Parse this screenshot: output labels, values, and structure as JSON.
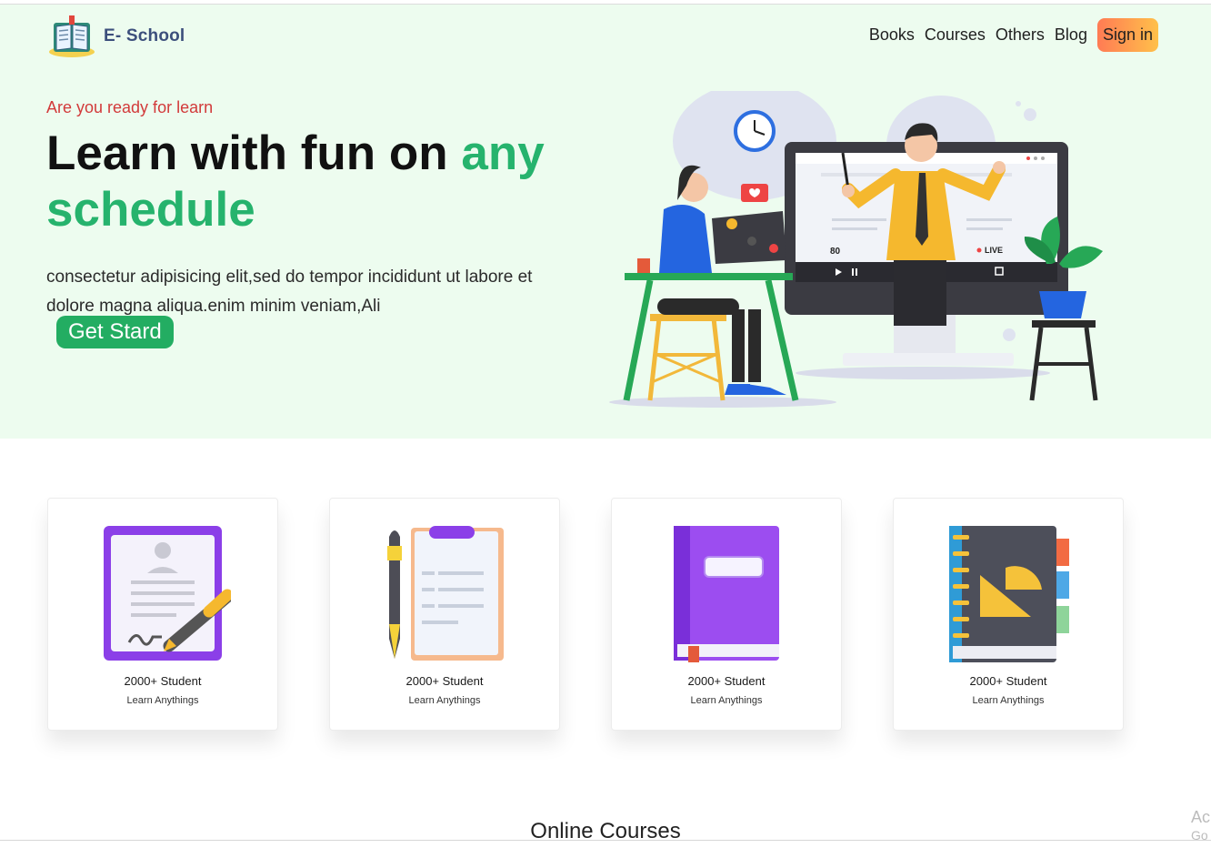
{
  "brand": {
    "name": "E- School",
    "logo_icon": "open-book-logo-icon"
  },
  "nav": {
    "items": [
      "Books",
      "Courses",
      "Others",
      "Blog"
    ],
    "signin_label": "Sign in"
  },
  "hero": {
    "tagline": "Are you ready for learn",
    "headline_part1": "Learn with fun on ",
    "headline_accent": "any schedule",
    "intro": "consectetur adipisicing elit,sed do tempor incididunt ut labore et dolore magna aliqua.enim minim veniam,Ali",
    "cta_label": "Get Stard",
    "illustration": {
      "viewer_count": "80",
      "live_label": "LIVE"
    }
  },
  "cards": [
    {
      "title": "2000+ Student",
      "subtitle": "Learn Anythings",
      "icon": "resume-pen-icon"
    },
    {
      "title": "2000+ Student",
      "subtitle": "Learn Anythings",
      "icon": "clipboard-pen-icon"
    },
    {
      "title": "2000+ Student",
      "subtitle": "Learn Anythings",
      "icon": "purple-book-icon"
    },
    {
      "title": "2000+ Student",
      "subtitle": "Learn Anythings",
      "icon": "geometry-notebook-icon"
    }
  ],
  "section": {
    "title": "Online Courses"
  },
  "watermark": {
    "line1": "Ac",
    "line2": "Go"
  },
  "colors": {
    "hero_bg": "#edfcef",
    "accent_green": "#26b36d",
    "tagline_red": "#d23a3a",
    "brand_text": "#3c4f7c"
  }
}
